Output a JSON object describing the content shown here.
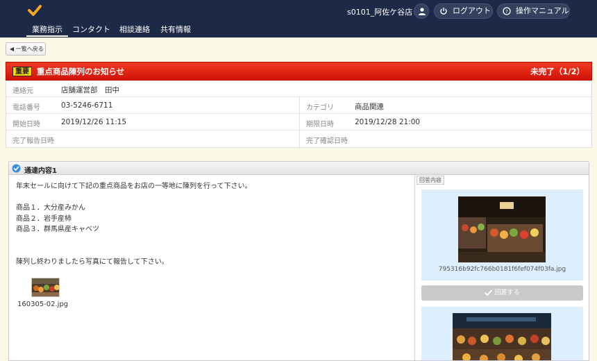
{
  "header": {
    "store": "s0101_阿佐ケ谷店",
    "logout_label": "ログアウト",
    "manual_label": "操作マニュアル",
    "nav": [
      {
        "label": "業務指示",
        "active": true
      },
      {
        "label": "コンタクト",
        "active": false
      },
      {
        "label": "相談連絡",
        "active": false
      },
      {
        "label": "共有情報",
        "active": false
      }
    ]
  },
  "back_label": "◀ 一覧へ戻る",
  "notice": {
    "badge": "重要",
    "title": "重点商品陳列のお知らせ",
    "status": "未完了（1/2）"
  },
  "info": {
    "contact_label": "連絡元",
    "contact_value": "店舗運営部　田中",
    "phone_label": "電話番号",
    "phone_value": "03-5246-6711",
    "category_label": "カテゴリ",
    "category_value": "商品関連",
    "start_label": "開始日時",
    "start_value": "2019/12/26 11:15",
    "due_label": "期限日時",
    "due_value": "2019/12/28 21:00",
    "report_label": "完了報告日時",
    "report_value": "",
    "confirm_label": "完了確認日時",
    "confirm_value": ""
  },
  "content": {
    "title": "通達内容1",
    "lines": [
      "年末セールに向けて下記の重点商品をお店の一等地に陳列を行って下さい。",
      "",
      "商品１．大分産みかん",
      "商品２．岩手産柿",
      "商品３．群馬県産キャベツ",
      "",
      "",
      "陳列し終わりましたら写真にて報告して下さい。"
    ],
    "attachment_name": "160305-02.jpg"
  },
  "answer": {
    "tab_label": "回答内容",
    "photo1_name": "795316b92fc766b0181f6fef074f03fa.jpg",
    "button_label": "回答する"
  },
  "colors": {
    "header_bg": "#1c2a48",
    "notice_red": "#e3200e",
    "badge_yellow": "#ffd800",
    "answer_bg": "#ddeefc"
  }
}
